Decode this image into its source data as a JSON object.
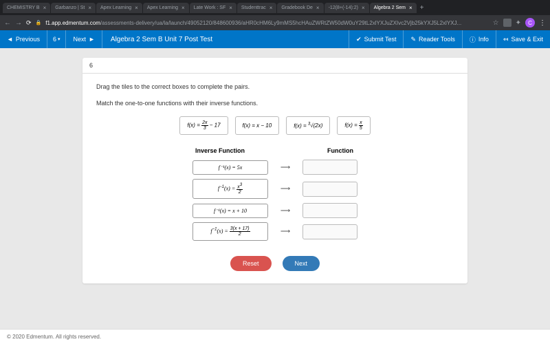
{
  "browser": {
    "tabs": [
      {
        "label": "CHEMISTRY B"
      },
      {
        "label": "Garbanzo | St"
      },
      {
        "label": "Apex Learning"
      },
      {
        "label": "Apex Learning"
      },
      {
        "label": "Late Work : SF"
      },
      {
        "label": "Studenttrac"
      },
      {
        "label": "Gradebook De"
      },
      {
        "label": "-12(8+(-14):2)"
      },
      {
        "label": "Algebra 2 Sem"
      }
    ],
    "url_host": "f1.app.edmentum.com",
    "url_path": "/assessments-delivery/ua/la/launch/49052120/848600936/aHR0cHM6Ly9mMS5hcHAuZWRtZW50dW0uY29tL2xlYXJuZXIvc2Vjb25kYXJ5L2xlYXJ...",
    "profile_letter": "C"
  },
  "appbar": {
    "prev": "Previous",
    "q": "6",
    "next": "Next",
    "title": "Algebra 2 Sem B Unit 7 Post Test",
    "submit": "Submit Test",
    "reader": "Reader Tools",
    "info": "Info",
    "save": "Save & Exit"
  },
  "question": {
    "num": "6",
    "instr1": "Drag the tiles to the correct boxes to complete the pairs.",
    "instr2": "Match the one-to-one functions with their inverse functions.",
    "tiles": [
      "f(x) = 2x/3 − 17",
      "f(x) = x − 10",
      "f(x) = ∛(2x)",
      "f(x) = x/5"
    ],
    "hdr_inv": "Inverse Function",
    "hdr_fn": "Function",
    "inverses": [
      "f⁻¹(x) = 5x",
      "f⁻¹(x) = x³/2",
      "f⁻¹(x) = x + 10",
      "f⁻¹(x) = 3(x + 17)/2"
    ],
    "reset": "Reset",
    "nextbtn": "Next"
  },
  "footer": "© 2020 Edmentum. All rights reserved."
}
